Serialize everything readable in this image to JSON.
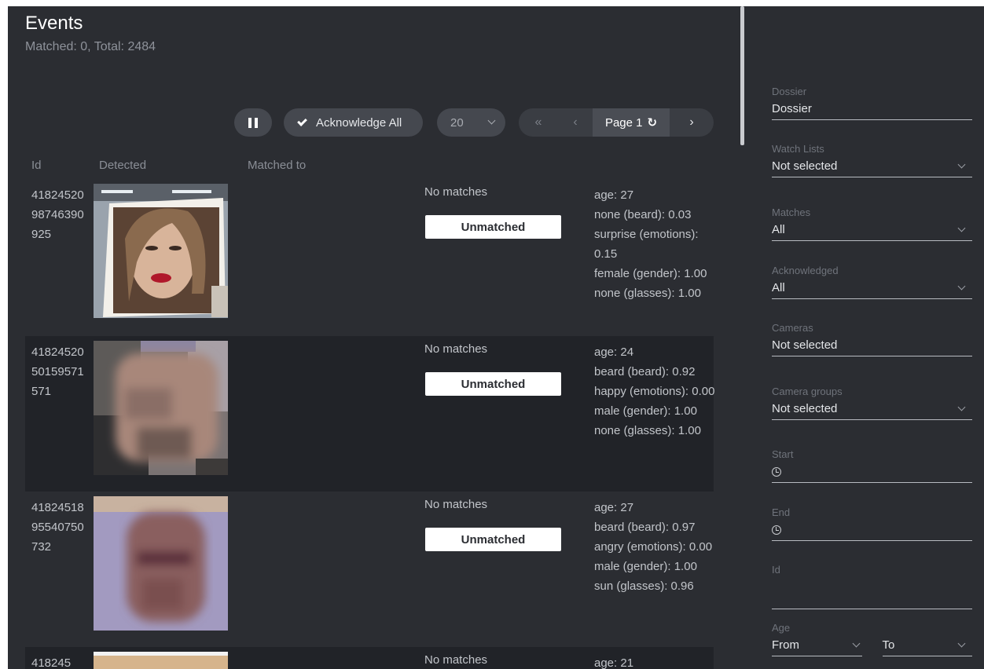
{
  "header": {
    "title": "Events",
    "summary": "Matched: 0, Total: 2484"
  },
  "toolbar": {
    "pause_icon": "pause-icon",
    "acknowledge_label": "Acknowledge All",
    "page_size": "20",
    "first_icon": "«",
    "prev_icon": "‹",
    "page_label": "Page 1",
    "refresh_icon": "↻",
    "next_icon": "›"
  },
  "table": {
    "columns": [
      "Id",
      "Detected",
      "Matched to"
    ],
    "rows": [
      {
        "id": "4182452098746390925",
        "match_text": "No matches",
        "status": "Unmatched",
        "attributes": [
          "age: 27",
          "none (beard): 0.03",
          "surprise (emotions): 0.15",
          "female (gender): 1.00",
          "none (glasses): 1.00"
        ]
      },
      {
        "id": "4182452050159571571",
        "match_text": "No matches",
        "status": "Unmatched",
        "attributes": [
          "age: 24",
          "beard (beard): 0.92",
          "happy (emotions): 0.00",
          "male (gender): 1.00",
          "none (glasses): 1.00"
        ]
      },
      {
        "id": "4182451895540750732",
        "match_text": "No matches",
        "status": "Unmatched",
        "attributes": [
          "age: 27",
          "beard (beard): 0.97",
          "angry (emotions): 0.00",
          "male (gender): 1.00",
          "sun (glasses): 0.96"
        ]
      },
      {
        "id": "418245",
        "match_text": "No matches",
        "status": "",
        "attributes": [
          "age: 21"
        ]
      }
    ]
  },
  "filters": {
    "dossier": {
      "label": "Dossier",
      "value": "Dossier"
    },
    "watch_lists": {
      "label": "Watch Lists",
      "value": "Not selected"
    },
    "matches": {
      "label": "Matches",
      "value": "All"
    },
    "acknowledged": {
      "label": "Acknowledged",
      "value": "All"
    },
    "cameras": {
      "label": "Cameras",
      "value": "Not selected"
    },
    "camera_groups": {
      "label": "Camera groups",
      "value": "Not selected"
    },
    "start": {
      "label": "Start"
    },
    "end": {
      "label": "End"
    },
    "id": {
      "label": "Id",
      "value": ""
    },
    "age": {
      "label": "Age",
      "from": "From",
      "to": "To"
    }
  },
  "colors": {
    "background": "#2b2d32",
    "row_alt": "#212328",
    "button": "#45484f",
    "status_badge": "#ffffff"
  }
}
